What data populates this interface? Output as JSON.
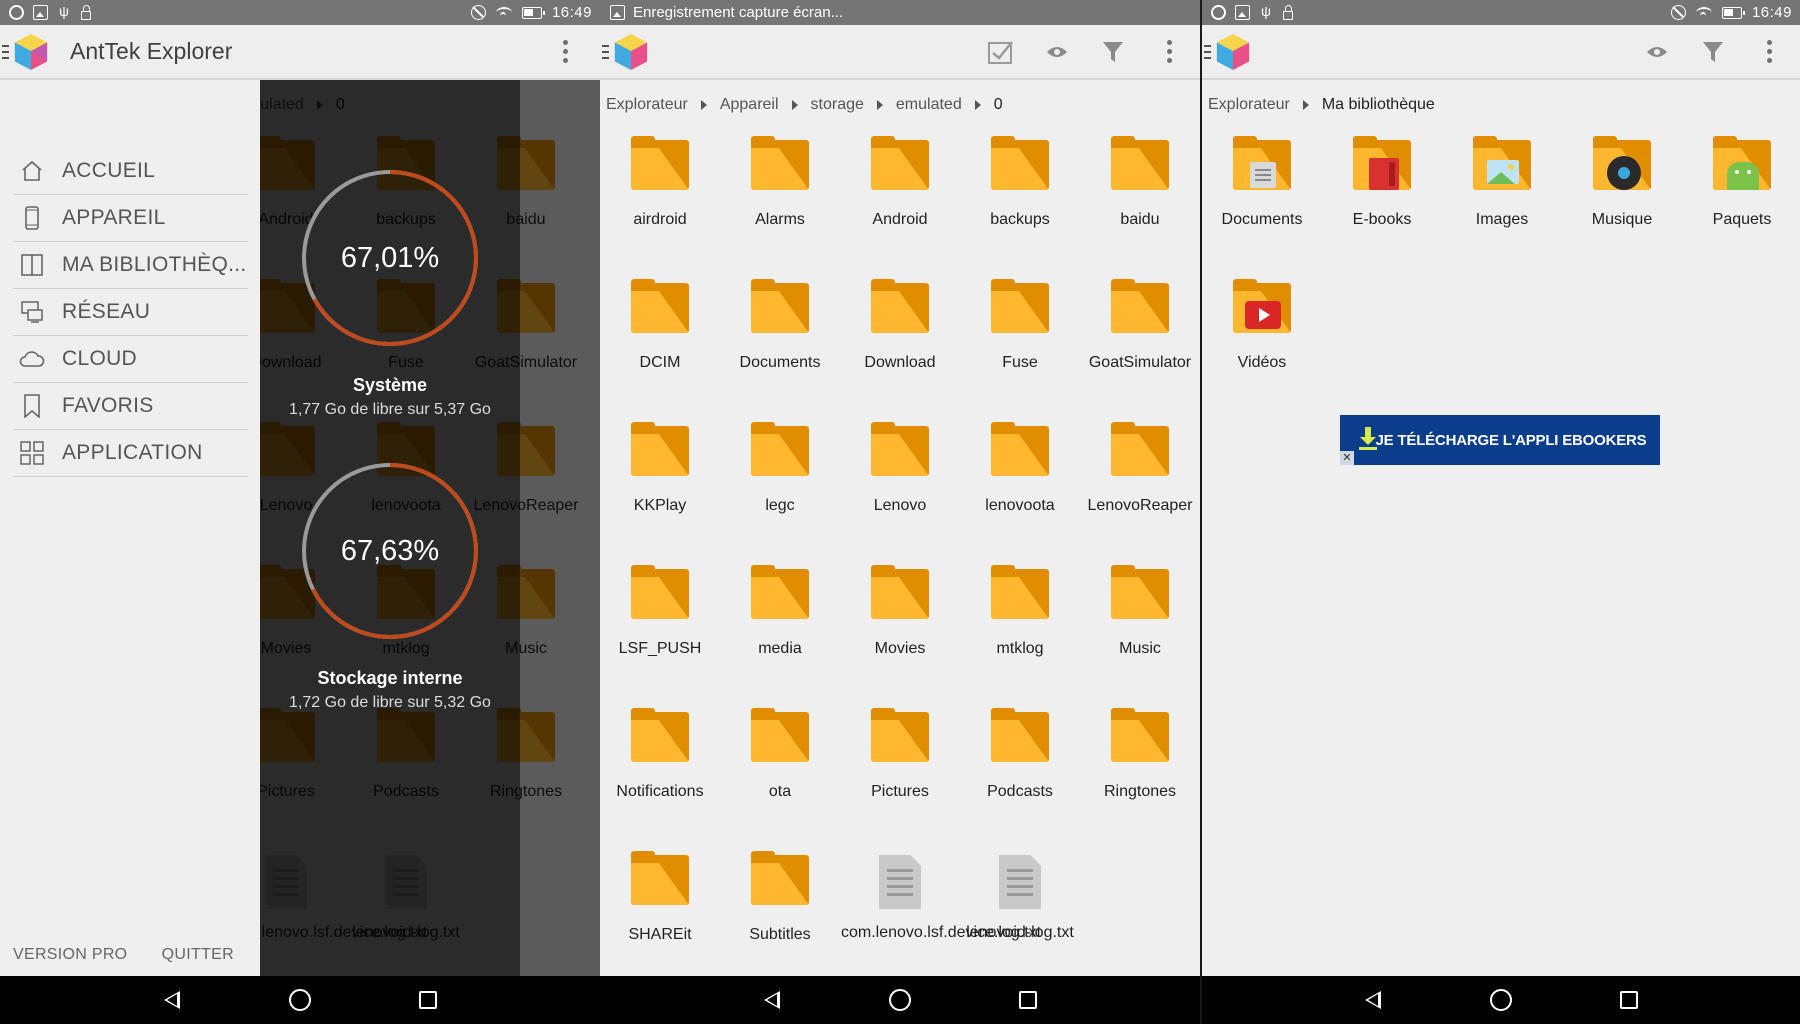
{
  "status": {
    "time": "16:49",
    "notification": "Enregistrement capture écran..."
  },
  "app": {
    "title": "AntTek Explorer"
  },
  "drawer": {
    "menu": [
      {
        "label": "ACCUEIL",
        "icon": "home-icon"
      },
      {
        "label": "APPAREIL",
        "icon": "phone-icon"
      },
      {
        "label": "MA BIBLIOTHÈQ...",
        "icon": "library-icon"
      },
      {
        "label": "RÉSEAU",
        "icon": "network-icon"
      },
      {
        "label": "CLOUD",
        "icon": "cloud-icon"
      },
      {
        "label": "FAVORIS",
        "icon": "bookmark-icon"
      },
      {
        "label": "APPLICATION",
        "icon": "apps-grid-icon"
      }
    ],
    "footer": {
      "pro": "VERSION PRO",
      "quit": "QUITTER"
    },
    "storage": [
      {
        "percent": "67,01%",
        "name": "Système",
        "free": "1,77 Go de libre sur 5,37 Go",
        "fraction": 0.6701
      },
      {
        "percent": "67,63%",
        "name": "Stockage interne",
        "free": "1,72 Go de libre sur 5,32 Go",
        "fraction": 0.6763
      }
    ],
    "colors": {
      "ring_used": "#c04a1c",
      "ring_free": "#9a9a9a"
    }
  },
  "background_view": {
    "crumbs": [
      "emulated",
      "0"
    ],
    "items": [
      {
        "name": "Android",
        "type": "folder"
      },
      {
        "name": "backups",
        "type": "folder"
      },
      {
        "name": "baidu",
        "type": "folder"
      },
      {
        "name": "Download",
        "type": "folder"
      },
      {
        "name": "Fuse",
        "type": "folder"
      },
      {
        "name": "GoatSimulator",
        "type": "folder"
      },
      {
        "name": "Lenovo",
        "type": "folder"
      },
      {
        "name": "lenovoota",
        "type": "folder"
      },
      {
        "name": "LenovoReaper",
        "type": "folder"
      },
      {
        "name": "Movies",
        "type": "folder"
      },
      {
        "name": "mtklog",
        "type": "folder"
      },
      {
        "name": "Music",
        "type": "folder"
      },
      {
        "name": "Pictures",
        "type": "folder"
      },
      {
        "name": "Podcasts",
        "type": "folder"
      },
      {
        "name": "Ringtones",
        "type": "folder"
      },
      {
        "name": "com.lenovo.lsf.device.log.txt",
        "type": "file"
      },
      {
        "name": "lenovoid-log.txt",
        "type": "file"
      }
    ]
  },
  "explorer": {
    "crumbs": [
      "Explorateur",
      "Appareil",
      "storage",
      "emulated",
      "0"
    ],
    "items": [
      {
        "name": "airdroid",
        "type": "folder"
      },
      {
        "name": "Alarms",
        "type": "folder"
      },
      {
        "name": "Android",
        "type": "folder"
      },
      {
        "name": "backups",
        "type": "folder"
      },
      {
        "name": "baidu",
        "type": "folder"
      },
      {
        "name": "DCIM",
        "type": "folder"
      },
      {
        "name": "Documents",
        "type": "folder"
      },
      {
        "name": "Download",
        "type": "folder"
      },
      {
        "name": "Fuse",
        "type": "folder"
      },
      {
        "name": "GoatSimulator",
        "type": "folder"
      },
      {
        "name": "KKPlay",
        "type": "folder"
      },
      {
        "name": "legc",
        "type": "folder"
      },
      {
        "name": "Lenovo",
        "type": "folder"
      },
      {
        "name": "lenovoota",
        "type": "folder"
      },
      {
        "name": "LenovoReaper",
        "type": "folder"
      },
      {
        "name": "LSF_PUSH",
        "type": "folder"
      },
      {
        "name": "media",
        "type": "folder"
      },
      {
        "name": "Movies",
        "type": "folder"
      },
      {
        "name": "mtklog",
        "type": "folder"
      },
      {
        "name": "Music",
        "type": "folder"
      },
      {
        "name": "Notifications",
        "type": "folder"
      },
      {
        "name": "ota",
        "type": "folder"
      },
      {
        "name": "Pictures",
        "type": "folder"
      },
      {
        "name": "Podcasts",
        "type": "folder"
      },
      {
        "name": "Ringtones",
        "type": "folder"
      },
      {
        "name": "SHAREit",
        "type": "folder"
      },
      {
        "name": "Subtitles",
        "type": "folder"
      },
      {
        "name": "com.lenovo.lsf.device.log.txt",
        "type": "file"
      },
      {
        "name": "lenovoid-log.txt",
        "type": "file"
      }
    ]
  },
  "library": {
    "crumbs": [
      "Explorateur",
      "Ma bibliothèque"
    ],
    "items": [
      {
        "name": "Documents",
        "badge": "document"
      },
      {
        "name": "E-books",
        "badge": "book"
      },
      {
        "name": "Images",
        "badge": "image"
      },
      {
        "name": "Musique",
        "badge": "disc"
      },
      {
        "name": "Paquets",
        "badge": "android"
      },
      {
        "name": "Vidéos",
        "badge": "video"
      }
    ],
    "ad": {
      "text": "JE TÉLÉCHARGE L'APPLI EBOOKERS",
      "close": "✕",
      "color": "#0a3e8c"
    }
  },
  "colors": {
    "folder_front": "#fcae24",
    "folder_back": "#e08e00"
  }
}
